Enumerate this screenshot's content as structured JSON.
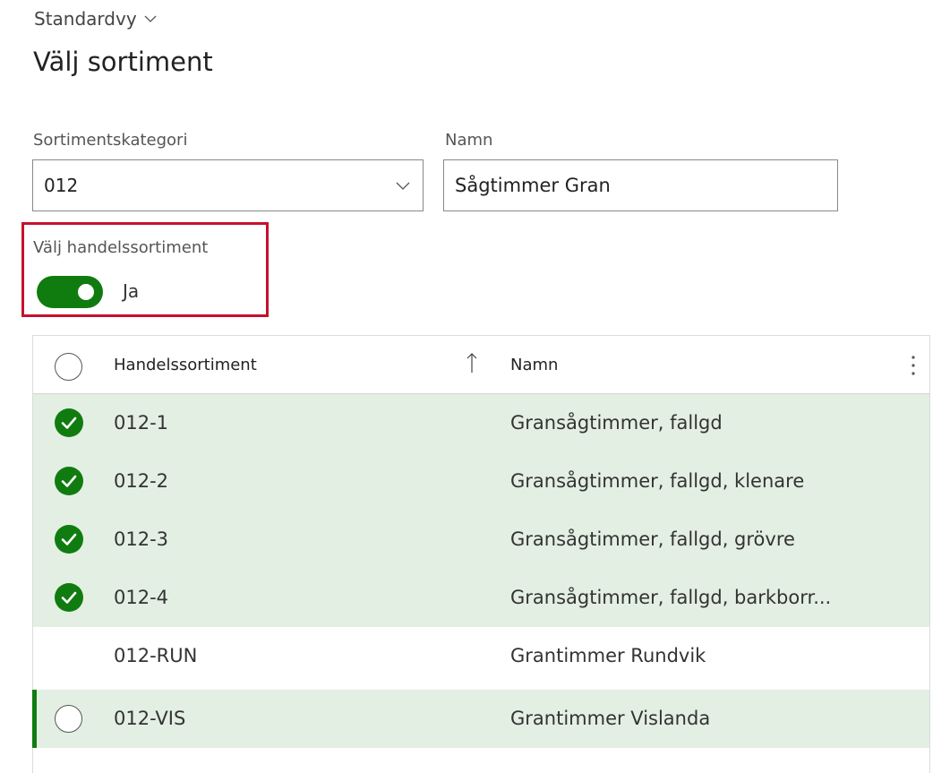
{
  "view": {
    "label": "Standardvy"
  },
  "page": {
    "title": "Välj sortiment"
  },
  "form": {
    "category": {
      "label": "Sortimentskategori",
      "value": "012"
    },
    "name": {
      "label": "Namn",
      "value": "Sågtimmer Gran"
    },
    "trade_toggle": {
      "label": "Välj handelssortiment",
      "value_text": "Ja",
      "on": true
    }
  },
  "grid": {
    "columns": {
      "col1": "Handelssortiment",
      "col2": "Namn"
    },
    "sort_indicator": "↑",
    "rows": [
      {
        "code": "012-1",
        "name": "Gransågtimmer, fallgd",
        "checked": true
      },
      {
        "code": "012-2",
        "name": "Gransågtimmer, fallgd, klenare",
        "checked": true
      },
      {
        "code": "012-3",
        "name": "Gransågtimmer, fallgd, grövre",
        "checked": true
      },
      {
        "code": "012-4",
        "name": "Gransågtimmer, fallgd, barkborr...",
        "checked": true
      },
      {
        "code": "012-RUN",
        "name": "Grantimmer Rundvik",
        "checked": false
      },
      {
        "code": "012-VIS",
        "name": "Grantimmer Vislanda",
        "checked": false,
        "current": true
      }
    ]
  },
  "colors": {
    "accent_green": "#107c10",
    "selected_row": "#e3efe3",
    "highlight_red": "#c8102e"
  }
}
